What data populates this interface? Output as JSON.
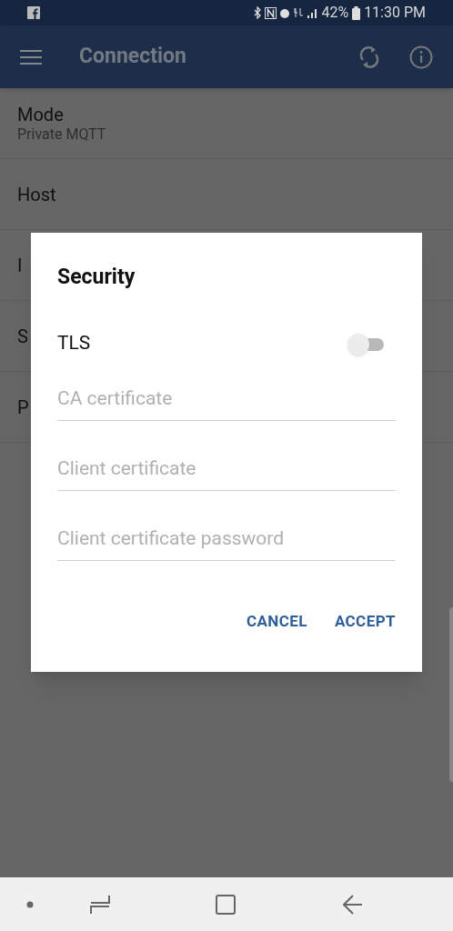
{
  "status_bar": {
    "battery": "42%",
    "time": "11:30 PM"
  },
  "app_bar": {
    "title": "Connection"
  },
  "settings": [
    {
      "label": "Mode",
      "value": "Private MQTT"
    },
    {
      "label": "Host"
    },
    {
      "label": "I"
    },
    {
      "label": "S"
    },
    {
      "label": "P"
    }
  ],
  "dialog": {
    "title": "Security",
    "toggle": {
      "label": "TLS",
      "on": false
    },
    "fields": [
      {
        "placeholder": "CA certificate"
      },
      {
        "placeholder": "Client certificate"
      },
      {
        "placeholder": "Client certificate password"
      }
    ],
    "buttons": [
      "CANCEL",
      "ACCEPT"
    ]
  }
}
